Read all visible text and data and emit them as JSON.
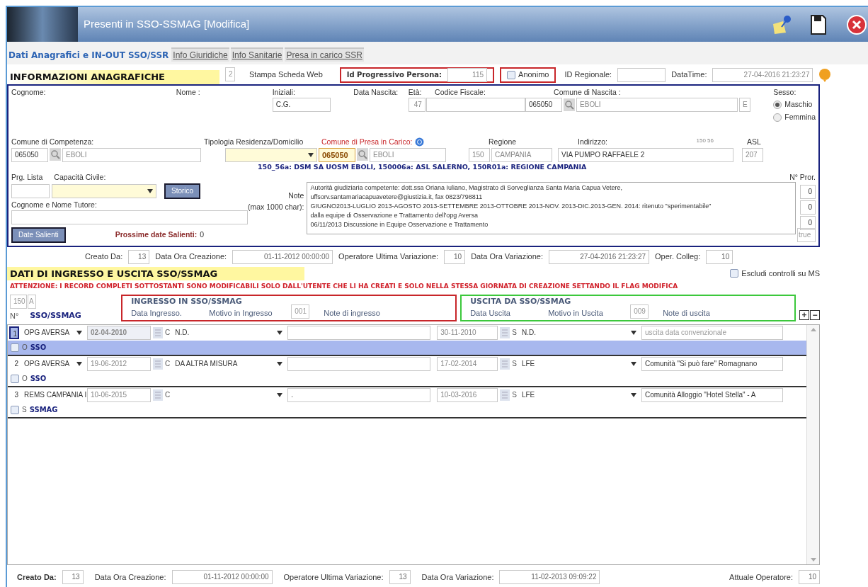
{
  "window": {
    "title": "Presenti in SSO-SSMAG [Modifica]"
  },
  "tabs": [
    {
      "label": "Dati Anagrafici e IN-OUT SSO/SSR",
      "selected": true
    },
    {
      "label": "Info Giuridiche",
      "selected": false
    },
    {
      "label": "Info Sanitarie",
      "selected": false
    },
    {
      "label": "Presa in carico SSR",
      "selected": false
    }
  ],
  "header": {
    "section_title": "INFORMAZIONI ANAGRAFICHE",
    "counter": "2",
    "print_link": "Stampa Scheda Web",
    "id_label": "Id Progressivo Persona:",
    "id_value": "115",
    "anonymous": {
      "label": "Anonimo",
      "checked": false
    },
    "regional_id_label": "ID Regionale:",
    "datetime_label": "DataTime:",
    "datetime_value": "27-04-2016 21:23:27"
  },
  "personal": {
    "surname_label": "Cognome:",
    "name_label": "Nome :",
    "initials": {
      "label": "Iniziali:",
      "value": "C.G."
    },
    "birth_date_label": "Data Nascita:",
    "age": {
      "label": "Età:",
      "value": "47"
    },
    "tax_code_label": "Codice Fiscale:",
    "birth_town": {
      "label": "Comune di Nascita :",
      "code": "065050",
      "name": "EBOLI",
      "province": "E"
    },
    "sex": {
      "label": "Sesso:",
      "options": [
        {
          "label": "Maschio",
          "selected": true
        },
        {
          "label": "Femmina",
          "selected": false
        }
      ]
    },
    "competence": {
      "label": "Comune di Competenza:",
      "code": "065050",
      "name": "EBOLI"
    },
    "residence_type_label": "Tipologia Residenza/Domicilio",
    "taking_charge": {
      "label": "Comune di Presa in Carico:",
      "code": "065050",
      "name": "EBOLI"
    },
    "region": {
      "label": "Regione",
      "code": "150",
      "name": "CAMPANIA"
    },
    "address": {
      "label": "Indirizzo:",
      "hint": "150 56",
      "value": "VIA PUMPO RAFFAELE 2"
    },
    "asl": {
      "label": "ASL",
      "value": "207"
    },
    "summary": "150_56a: DSM SA UOSM EBOLI, 150006a: ASL SALERNO, 150R01a: REGIONE CAMPANIA",
    "list_label": "Prg. Lista",
    "civil_capacity_label": "Capacità Civile:",
    "history_button": "Storico",
    "notes_label": "Note",
    "notes_limit": "(max 1000 char):",
    "notes": [
      "Autorità giudiziaria competente: dott.ssa Oriana Iuliano, Magistrato di Sorveglianza Santa Maria Capua Vetere,",
      "uffsorv.santamariacapuavetere@giustizia.it, fax 0823/798811",
      "GIUGNO2013-LUGLIO 2013-AGOSTO 2013-SETTEMBRE 2013-OTTOBRE 2013-NOV. 2013-DIC.2013-GEN. 2014: ritenuto \"sperimentabile\"",
      "dalla equipe di Osservazione e Trattamento dell'opg Aversa",
      "06/11/2013 Discussione in Equipe Osservazione e Trattamento"
    ],
    "extensions_label": "N° Pror.",
    "extensions": [
      "0",
      "0",
      "0"
    ],
    "flag": "true",
    "guardian_label": "Cognome e Nome Tutore:",
    "key_dates_button": "Date Salienti",
    "next_dates": {
      "label": "Prossime date Salienti:",
      "value": "0"
    }
  },
  "audit": [
    {
      "label": "Creato Da:",
      "value": "13",
      "kind": "short"
    },
    {
      "label": "Data Ora Creazione:",
      "value": "01-11-2012 00:00:00",
      "kind": "long"
    },
    {
      "label": "Operatore Ultima Variazione:",
      "value": "10",
      "kind": "short"
    },
    {
      "label": "Data Ora Variazione:",
      "value": "27-04-2016 21:23:27",
      "kind": "long"
    },
    {
      "label": "Oper. Colleg:",
      "value": "10",
      "kind": "medium"
    }
  ],
  "movements": {
    "title": "DATI DI INGRESSO E USCITA SSO/SSMAG",
    "exclude": {
      "label": "Escludi controlli su MS",
      "checked": false
    },
    "warning": "ATTENZIONE: I RECORD COMPLETI SOTTOSTANTI SONO MODIFICABILI SOLO DALL'UTENTE CHE LI HA CREATI E SOLO NELLA STESSA GIORNATA DI CREAZIONE SETTANDO IL FLAG MODIFICA",
    "region_code": "150",
    "region_flag": "A",
    "number_header": "N°",
    "facility_header": "SSO/SSMAG",
    "entry": {
      "title": "INGRESSO IN SSO/SSMAG",
      "date_label": "Data Ingresso.",
      "reason_label": "Motivo in Ingresso",
      "code": "001",
      "notes_label": "Note di ingresso"
    },
    "exit": {
      "title": "USCITA DA SSO/SSMAG",
      "date_label": "Data Uscita",
      "reason_label": "Motivo in Uscita",
      "code": "009",
      "notes_label": "Note di uscita"
    },
    "add": "+",
    "remove": "−",
    "rows": [
      {
        "number": "1",
        "facility": "OPG AVERSA",
        "entry_date": "02-04-2010",
        "entry_type": "C",
        "entry_reason": "N.D.",
        "entry_note": "",
        "exit_date": "30-11-2010",
        "exit_type": "S",
        "exit_reason": "N.D.",
        "exit_note": "uscita data convenzionale",
        "type_code": "O",
        "type": "SSO",
        "checked": false,
        "selected": true
      },
      {
        "number": "2",
        "facility": "OPG AVERSA",
        "entry_date": "19-06-2012",
        "entry_type": "C",
        "entry_reason": "DA ALTRA MISURA",
        "entry_note": "",
        "exit_date": "17-02-2014",
        "exit_type": "S",
        "exit_reason": "LFE",
        "exit_note": "Comunità \"Si può fare\" Romagnano",
        "type_code": "O",
        "type": "SSO",
        "checked": false,
        "selected": false
      },
      {
        "number": "3",
        "facility": "REMS CAMPANIA I",
        "entry_date": "10-06-2015",
        "entry_type": "C",
        "entry_reason": "",
        "entry_note": ".",
        "exit_date": "10-03-2016",
        "exit_type": "S",
        "exit_reason": "LFE",
        "exit_note": "Comunità Alloggio \"Hotel Stella\" - A",
        "type_code": "S",
        "type": "SSMAG",
        "checked": false,
        "selected": false
      }
    ]
  },
  "footer": [
    {
      "label": "Creato Da:",
      "value": "13",
      "kind": "bold"
    },
    {
      "label": "Data Ora Creazione:",
      "value": "01-11-2012 00:00:00",
      "kind": "plain"
    },
    {
      "label": "Operatore Ultima Variazione:",
      "value": "13",
      "kind": "plain"
    },
    {
      "label": "Data Ora Variazione:",
      "value": "11-02-2013 09:09:22",
      "kind": "plain"
    },
    {
      "label": "Attuale Operatore:",
      "value": "10",
      "kind": "right"
    }
  ]
}
